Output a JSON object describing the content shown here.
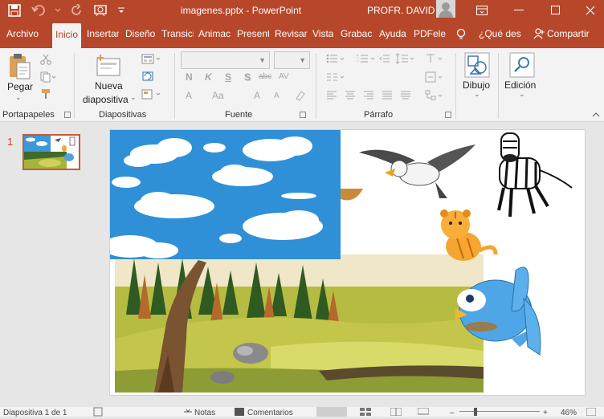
{
  "window": {
    "title": "imagenes.pptx  -  PowerPoint",
    "user": "PROFR. DAVID"
  },
  "tabs": [
    "Archivo",
    "Inicio",
    "Insertar",
    "Diseño",
    "Transiciones",
    "Animaciones",
    "Presentación",
    "Revisar",
    "Vista",
    "Grabación",
    "Ayuda",
    "PDFelement"
  ],
  "tab_labels": {
    "archivo": "Archivo",
    "inicio": "Inicio",
    "insertar": "Insertar",
    "diseno": "Diseño",
    "transiciones": "Transici",
    "animaciones": "Animac",
    "presentacion": "Present",
    "revisar": "Revisar",
    "vista": "Vista",
    "grabacion": "Grabac",
    "ayuda": "Ayuda",
    "pdfelement": "PDFelei"
  },
  "tell_me": "¿Qué des",
  "share": "Compartir",
  "ribbon": {
    "groups": {
      "portapapeles": "Portapapeles",
      "diapositivas": "Diapositivas",
      "fuente": "Fuente",
      "parrafo": "Párrafo"
    },
    "pegar": "Pegar",
    "nueva": "Nueva",
    "diapositiva": "diapositiva",
    "dibujo": "Dibujo",
    "edicion": "Edición",
    "font_buttons": {
      "bold": "N",
      "italic": "K",
      "underline": "S",
      "shadow": "S",
      "strike": "abc",
      "spacing": "AV",
      "case": "Aa",
      "grow": "A",
      "shrink": "A",
      "color": "A"
    }
  },
  "thumbnails": [
    {
      "number": "1"
    }
  ],
  "status": {
    "slide_info": "Diapositiva 1 de 1",
    "notes": "Notas",
    "comments": "Comentarios",
    "zoom": "46%"
  },
  "colors": {
    "accent": "#b7472a",
    "ribbon_bg": "#f3f3f3",
    "workspace_bg": "#e6e6e6"
  }
}
